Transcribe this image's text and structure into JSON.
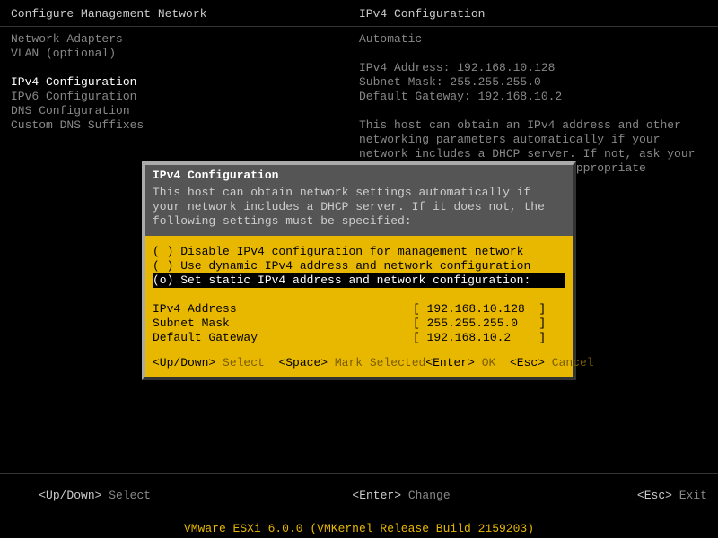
{
  "header": {
    "left": "Configure Management Network",
    "right": "IPv4 Configuration"
  },
  "sidebar": {
    "items": [
      "Network Adapters",
      "VLAN (optional)",
      "",
      "IPv4 Configuration",
      "IPv6 Configuration",
      "DNS Configuration",
      "Custom DNS Suffixes"
    ],
    "selected_index": 3
  },
  "info": {
    "mode": "Automatic",
    "lines": [
      "IPv4 Address: 192.168.10.128",
      "Subnet Mask: 255.255.255.0",
      "Default Gateway: 192.168.10.2"
    ],
    "desc": "This host can obtain an IPv4 address and other networking parameters automatically if your network includes a DHCP server. If not, ask your network administrator for the appropriate settings."
  },
  "dialog": {
    "title": "IPv4 Configuration",
    "desc": "This host can obtain network settings automatically if your network includes a DHCP server. If it does not, the following settings must be specified:",
    "options": [
      {
        "marker": "( )",
        "label": "Disable IPv4 configuration for management network"
      },
      {
        "marker": "( )",
        "label": "Use dynamic IPv4 address and network configuration"
      },
      {
        "marker": "(o)",
        "label": "Set static IPv4 address and network configuration:"
      }
    ],
    "selected_option": 2,
    "fields": [
      {
        "label": "IPv4 Address",
        "value": "[ 192.168.10.128  ]"
      },
      {
        "label": "Subnet Mask",
        "value": "[ 255.255.255.0   ]"
      },
      {
        "label": "Default Gateway",
        "value": "[ 192.168.10.2    ]"
      }
    ],
    "hints": {
      "updown_key": "<Up/Down>",
      "updown_act": "Select",
      "space_key": "<Space>",
      "space_act": "Mark Selected",
      "enter_key": "<Enter>",
      "enter_act": "OK",
      "esc_key": "<Esc>",
      "esc_act": "Cancel"
    }
  },
  "footer1": {
    "updown_key": "<Up/Down>",
    "updown_act": "Select",
    "enter_key": "<Enter>",
    "enter_act": "Change",
    "esc_key": "<Esc>",
    "esc_act": "Exit"
  },
  "footer2": "VMware ESXi 6.0.0 (VMKernel Release Build 2159203)"
}
